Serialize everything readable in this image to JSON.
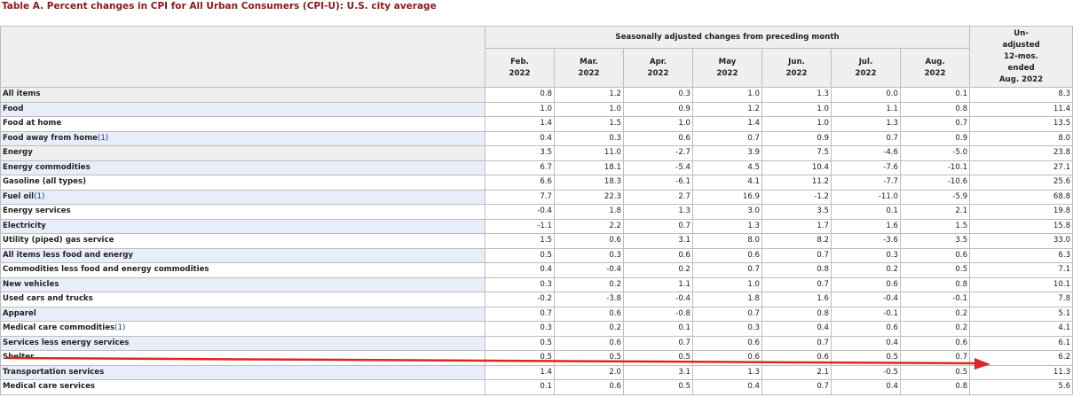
{
  "title": "Table A. Percent changes in CPI for All Urban Consumers (CPI-U): U.S. city average",
  "header": {
    "group_label": "Seasonally adjusted changes from preceding month",
    "months": [
      {
        "month": "Feb.",
        "year": "2022"
      },
      {
        "month": "Mar.",
        "year": "2022"
      },
      {
        "month": "Apr.",
        "year": "2022"
      },
      {
        "month": "May",
        "year": "2022"
      },
      {
        "month": "Jun.",
        "year": "2022"
      },
      {
        "month": "Jul.",
        "year": "2022"
      },
      {
        "month": "Aug.",
        "year": "2022"
      }
    ],
    "unadjusted": [
      "Un-",
      "adjusted",
      "12-mos.",
      "ended",
      "Aug. 2022"
    ]
  },
  "rows": [
    {
      "label": "All items",
      "fn": "",
      "values": [
        "0.8",
        "1.2",
        "0.3",
        "1.0",
        "1.3",
        "0.0",
        "0.1",
        "8.3"
      ]
    },
    {
      "label": "Food",
      "fn": "",
      "values": [
        "1.0",
        "1.0",
        "0.9",
        "1.2",
        "1.0",
        "1.1",
        "0.8",
        "11.4"
      ]
    },
    {
      "label": "Food at home",
      "fn": "",
      "values": [
        "1.4",
        "1.5",
        "1.0",
        "1.4",
        "1.0",
        "1.3",
        "0.7",
        "13.5"
      ]
    },
    {
      "label": "Food away from home",
      "fn": "(1)",
      "values": [
        "0.4",
        "0.3",
        "0.6",
        "0.7",
        "0.9",
        "0.7",
        "0.9",
        "8.0"
      ]
    },
    {
      "label": "Energy",
      "fn": "",
      "values": [
        "3.5",
        "11.0",
        "-2.7",
        "3.9",
        "7.5",
        "-4.6",
        "-5.0",
        "23.8"
      ]
    },
    {
      "label": "Energy commodities",
      "fn": "",
      "values": [
        "6.7",
        "18.1",
        "-5.4",
        "4.5",
        "10.4",
        "-7.6",
        "-10.1",
        "27.1"
      ]
    },
    {
      "label": "Gasoline (all types)",
      "fn": "",
      "values": [
        "6.6",
        "18.3",
        "-6.1",
        "4.1",
        "11.2",
        "-7.7",
        "-10.6",
        "25.6"
      ]
    },
    {
      "label": "Fuel oil",
      "fn": "(1)",
      "values": [
        "7.7",
        "22.3",
        "2.7",
        "16.9",
        "-1.2",
        "-11.0",
        "-5.9",
        "68.8"
      ]
    },
    {
      "label": "Energy services",
      "fn": "",
      "values": [
        "-0.4",
        "1.8",
        "1.3",
        "3.0",
        "3.5",
        "0.1",
        "2.1",
        "19.8"
      ]
    },
    {
      "label": "Electricity",
      "fn": "",
      "values": [
        "-1.1",
        "2.2",
        "0.7",
        "1.3",
        "1.7",
        "1.6",
        "1.5",
        "15.8"
      ]
    },
    {
      "label": "Utility (piped) gas service",
      "fn": "",
      "values": [
        "1.5",
        "0.6",
        "3.1",
        "8.0",
        "8.2",
        "-3.6",
        "3.5",
        "33.0"
      ]
    },
    {
      "label": "All items less food and energy",
      "fn": "",
      "values": [
        "0.5",
        "0.3",
        "0.6",
        "0.6",
        "0.7",
        "0.3",
        "0.6",
        "6.3"
      ]
    },
    {
      "label": "Commodities less food and energy commodities",
      "fn": "",
      "values": [
        "0.4",
        "-0.4",
        "0.2",
        "0.7",
        "0.8",
        "0.2",
        "0.5",
        "7.1"
      ]
    },
    {
      "label": "New vehicles",
      "fn": "",
      "values": [
        "0.3",
        "0.2",
        "1.1",
        "1.0",
        "0.7",
        "0.6",
        "0.8",
        "10.1"
      ]
    },
    {
      "label": "Used cars and trucks",
      "fn": "",
      "values": [
        "-0.2",
        "-3.8",
        "-0.4",
        "1.8",
        "1.6",
        "-0.4",
        "-0.1",
        "7.8"
      ]
    },
    {
      "label": "Apparel",
      "fn": "",
      "values": [
        "0.7",
        "0.6",
        "-0.8",
        "0.7",
        "0.8",
        "-0.1",
        "0.2",
        "5.1"
      ]
    },
    {
      "label": "Medical care commodities",
      "fn": "(1)",
      "values": [
        "0.3",
        "0.2",
        "0.1",
        "0.3",
        "0.4",
        "0.6",
        "0.2",
        "4.1"
      ]
    },
    {
      "label": "Services less energy services",
      "fn": "",
      "values": [
        "0.5",
        "0.6",
        "0.7",
        "0.6",
        "0.7",
        "0.4",
        "0.6",
        "6.1"
      ]
    },
    {
      "label": "Shelter",
      "fn": "",
      "values": [
        "0.5",
        "0.5",
        "0.5",
        "0.6",
        "0.6",
        "0.5",
        "0.7",
        "6.2"
      ]
    },
    {
      "label": "Transportation services",
      "fn": "",
      "values": [
        "1.4",
        "2.0",
        "3.1",
        "1.3",
        "2.1",
        "-0.5",
        "0.5",
        "11.3"
      ]
    },
    {
      "label": "Medical care services",
      "fn": "",
      "values": [
        "0.1",
        "0.6",
        "0.5",
        "0.4",
        "0.7",
        "0.4",
        "0.8",
        "5.6"
      ]
    }
  ],
  "annotation": {
    "arrow_color": "#e02424"
  }
}
